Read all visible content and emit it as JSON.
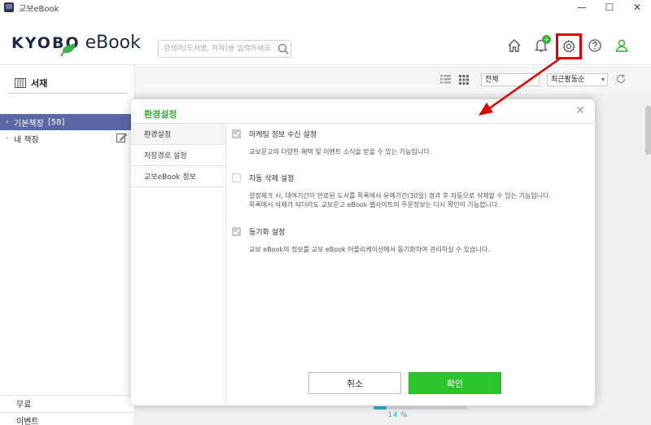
{
  "window": {
    "title": "교보eBook",
    "minimize": "—",
    "maximize": "☐",
    "close": "✕"
  },
  "header": {
    "logo_kyobo": "KYOBO",
    "logo_ebook": "eBook",
    "search_placeholder": "검색어(도서명, 저자)를 입력하세요.",
    "notification_badge": "+",
    "icons": [
      "home-icon",
      "bell-icon",
      "gear-icon",
      "help-icon",
      "user-icon"
    ]
  },
  "sidebar": {
    "title": "서재",
    "items": [
      {
        "label": "기본책장",
        "count": "[58]",
        "active": true
      },
      {
        "label": "내 책장",
        "count": "",
        "active": false
      }
    ],
    "bottom_items": [
      "무료",
      "이벤트"
    ]
  },
  "main": {
    "filter_all": "전체",
    "sort": "최근활동순",
    "progress_percent": 14,
    "progress_label": "14 %"
  },
  "dialog": {
    "title": "환경설정",
    "close": "✕",
    "nav": [
      {
        "label": "환경설정",
        "active": true
      },
      {
        "label": "저장경로 설정",
        "active": false
      },
      {
        "label": "교보eBook 정보",
        "active": false
      }
    ],
    "options": [
      {
        "label": "마케팅 정보 수신 설정",
        "checked": true,
        "desc": [
          "교보문고의 다양한 혜택 및 이벤트 소식을 받을 수 있는 기능입니다."
        ]
      },
      {
        "label": "자동 삭제 설정",
        "checked": false,
        "desc": [
          "설정체크 시, 대여기간이 만료된 도서를 목록에서 유예기간(30일) 경과 후 자동으로 삭제할 수 있는 기능입니다.",
          "목록에서 삭제가 되더라도 교보문고 eBook 웹사이트의 주문정보는 다시 확인이 가능합니다."
        ]
      },
      {
        "label": "동기화 설정",
        "checked": true,
        "desc": [
          "교보 eBook의 정보를 교보 eBook 어플리케이션에서 동기화하여 관리하실 수 있습니다."
        ]
      }
    ],
    "cancel_label": "취소",
    "ok_label": "확인"
  },
  "colors": {
    "accent_green": "#2cc42c",
    "sidebar_active": "#5b67a5",
    "annotation_red": "#e00000",
    "progress": "#27b5c6"
  }
}
